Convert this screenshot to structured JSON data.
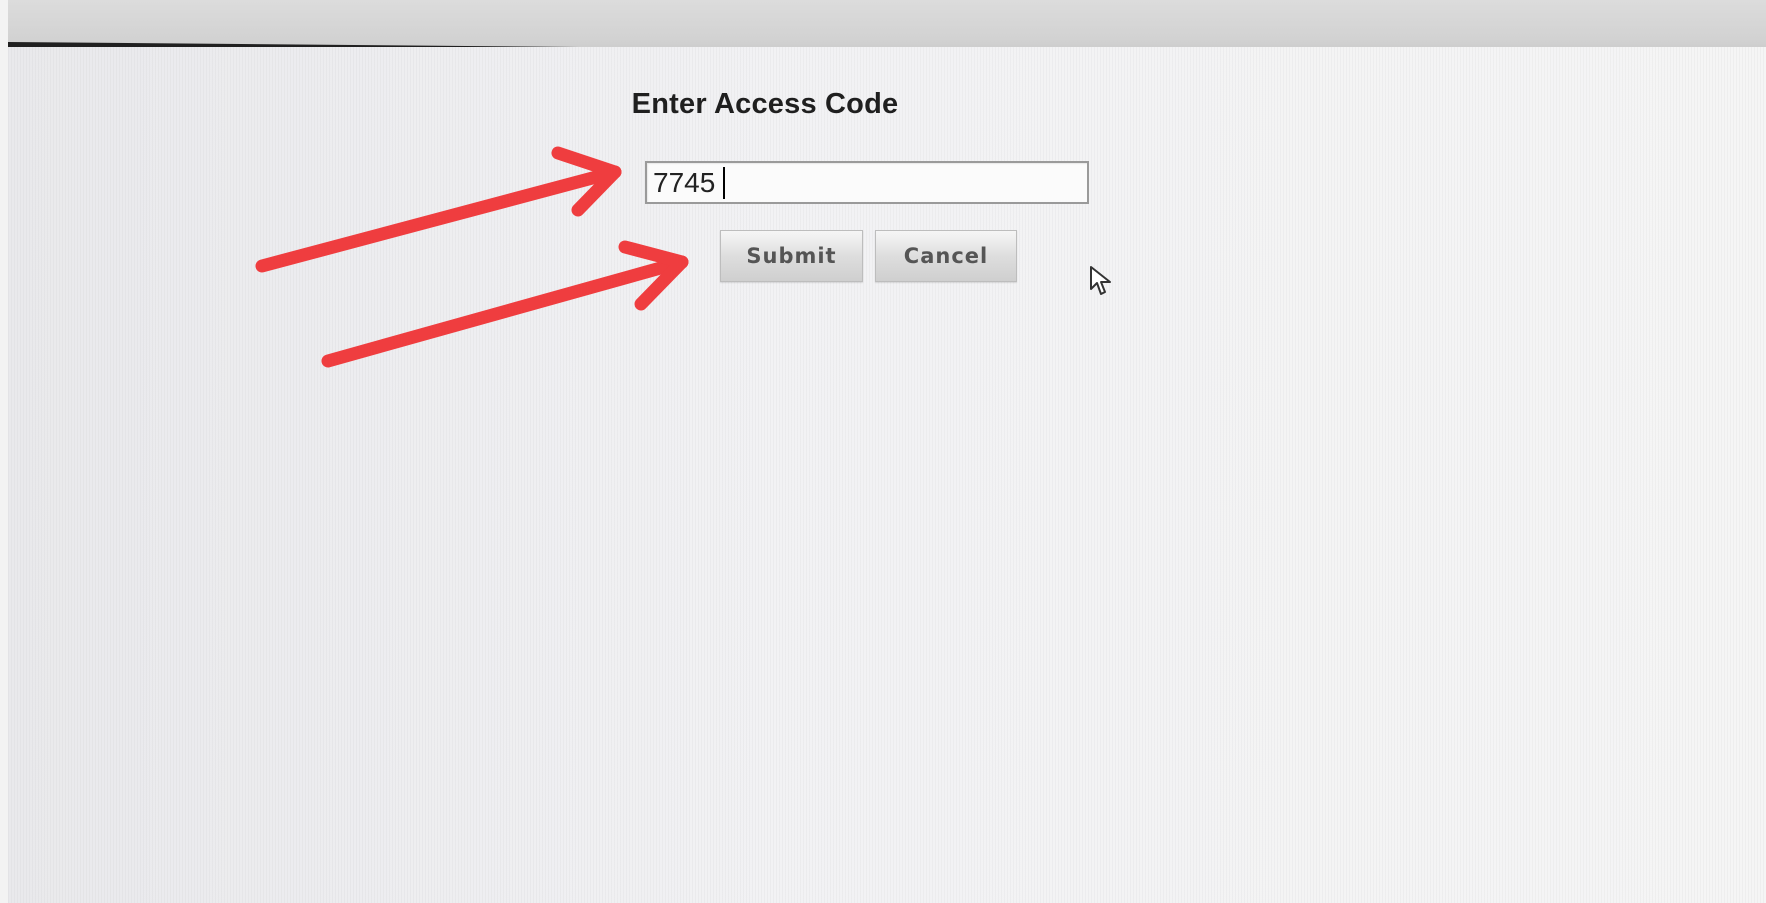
{
  "dialog": {
    "title": "Enter Access Code",
    "access_code_value": "7745",
    "submit_label": "Submit",
    "cancel_label": "Cancel"
  },
  "cursor_icon": "mouse-pointer-icon",
  "annotation_colors": {
    "arrow": "#ef3d3f"
  }
}
